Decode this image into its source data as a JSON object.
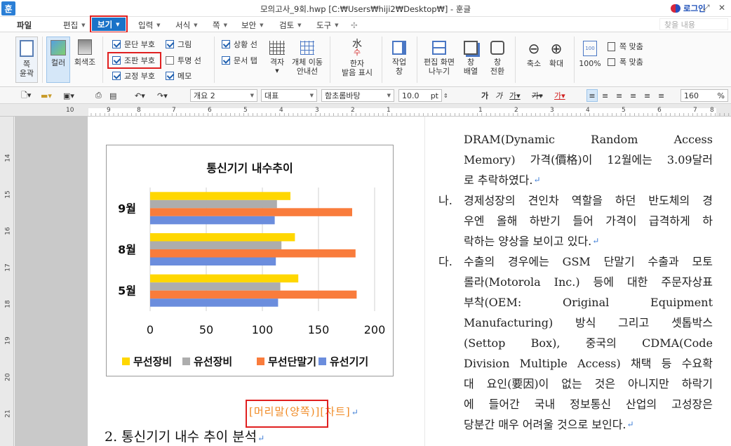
{
  "window": {
    "app_icon_label": "훈",
    "title": "모의고사_9회.hwp [C:₩Users₩hiji2₩Desktop₩] - 훈글",
    "login_label": "로그인"
  },
  "menu": {
    "items": [
      "파일",
      "편집",
      "보기",
      "입력",
      "서식",
      "쪽",
      "보안",
      "검토",
      "도구"
    ],
    "active": "보기",
    "search_placeholder": "찾을 내용"
  },
  "ribbon": {
    "page_outline": "쪽\n윤곽",
    "color": "컬러",
    "grayscale": "회색조",
    "checks": [
      {
        "label": "문단 부호",
        "checked": true
      },
      {
        "label": "조판 부호",
        "checked": true
      },
      {
        "label": "교정 부호",
        "checked": true
      },
      {
        "label": "그림",
        "checked": true
      },
      {
        "label": "투명 선",
        "checked": false
      },
      {
        "label": "메모",
        "checked": true
      },
      {
        "label": "상황 선",
        "checked": true
      },
      {
        "label": "문서 탭",
        "checked": true
      }
    ],
    "grid": "격자",
    "object_guide": "개체 이동\n안내선",
    "hanja": "한자\n발음 표시",
    "work_window": "작업\n창",
    "split_screen": "편집 화면\n나누기",
    "arrange_window": "창\n배열",
    "switch_window": "창\n전환",
    "zoom_out": "축소",
    "zoom_in": "확대",
    "zoom_100": "100%",
    "fit_page": "쪽 맞춤",
    "fit_width": "폭 맞춤"
  },
  "toolbar": {
    "style": "개요 2",
    "font_lang": "대표",
    "font_name": "함초롬바탕",
    "font_size": "10.0",
    "unit": "pt",
    "zoom": "160",
    "zoom_unit": "%"
  },
  "ruler": {
    "top": [
      "10",
      "9",
      "8",
      "7",
      "6",
      "5",
      "4",
      "3",
      "2",
      "1",
      "1",
      "2",
      "3",
      "4",
      "5",
      "6",
      "7",
      "8"
    ],
    "left": [
      "14",
      "15",
      "16",
      "17",
      "18",
      "19",
      "20",
      "21"
    ]
  },
  "chart_data": {
    "type": "bar",
    "orientation": "horizontal",
    "title": "통신기기 내수추이",
    "categories": [
      "9월",
      "8월",
      "5월"
    ],
    "series": [
      {
        "name": "무선장비",
        "color": "#FFD700",
        "values": [
          125,
          129,
          132
        ]
      },
      {
        "name": "유선장비",
        "color": "#ADADAD",
        "values": [
          113,
          117,
          116
        ]
      },
      {
        "name": "무선단말기",
        "color": "#F97C3C",
        "values": [
          180,
          183,
          184
        ]
      },
      {
        "name": "유선기기",
        "color": "#6B8DDD",
        "values": [
          111,
          112,
          114
        ]
      }
    ],
    "xlim": [
      0,
      200
    ],
    "xticks": [
      "0",
      "50",
      "100",
      "150",
      "200"
    ],
    "grid": true,
    "legend_position": "bottom"
  },
  "document": {
    "caption_left": "[머리말(양쪽)]",
    "caption_right": "[차트]",
    "heading": "2. 통신기기 내수 추이 분석",
    "paragraphs": [
      {
        "marker": "",
        "lines": [
          "DRAM(Dynamic Random Access",
          "Memory) 가격(價格)이 12월에는 3.09달러",
          "로 추락하였다."
        ]
      },
      {
        "marker": "나.",
        "lines": [
          "경제성장의 견인차 역할을 하던 반도체의 경",
          "우엔 올해 하반기 들어 가격이 급격하게 하",
          "락하는 양상을 보이고 있다."
        ]
      },
      {
        "marker": "다.",
        "lines": [
          "수출의 경우에는 GSM 단말기 수출과 모토",
          "롤라(Motorola Inc.) 등에 대한 주문자상표",
          "부착(OEM: Original Equipment",
          "Manufacturing) 방식 그리고 셋톱박스",
          "(Settop Box), 중국의 CDMA(Code",
          "Division Multiple Access) 채택 등 수요확",
          "대 요인(要因)이 없는 것은 아니지만 하락기",
          "에 들어간 국내 정보통신 산업의 고성장은",
          "당분간 매우 어려울 것으로 보인다."
        ]
      }
    ]
  }
}
